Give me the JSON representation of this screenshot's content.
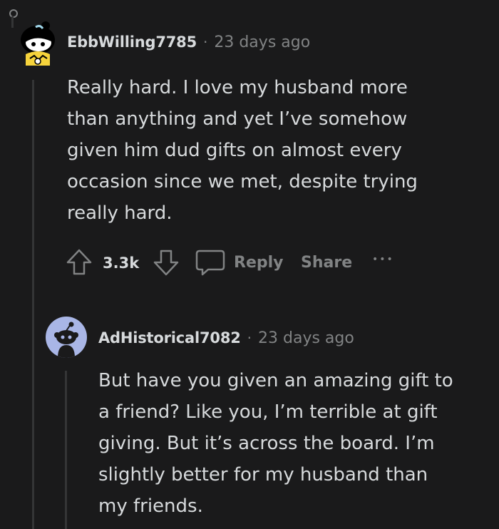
{
  "comments": [
    {
      "author": "EbbWilling7785",
      "separator": "·",
      "time": "23 days ago",
      "lines": [
        "Really hard. I love my husband more",
        "than anything and yet I’ve somehow",
        "given him dud gifts on almost every",
        "occasion since we met, despite trying",
        "really hard."
      ],
      "score": "3.3k",
      "reply_label": "Reply",
      "share_label": "Share",
      "more_label": "•••"
    },
    {
      "author": "AdHistorical7082",
      "separator": "·",
      "time": "23 days ago",
      "lines": [
        "But have you given an amazing gift to",
        "a friend? Like you, I’m terrible at gift",
        "giving. But it’s across the board. I’m",
        "slightly better for my husband than",
        "my friends."
      ]
    }
  ],
  "colors": {
    "background": "#1a1a1b",
    "text": "#d7dadc",
    "meta": "#818384",
    "thread_line": "#343536",
    "avatar2_bg": "#a9b6e6"
  }
}
